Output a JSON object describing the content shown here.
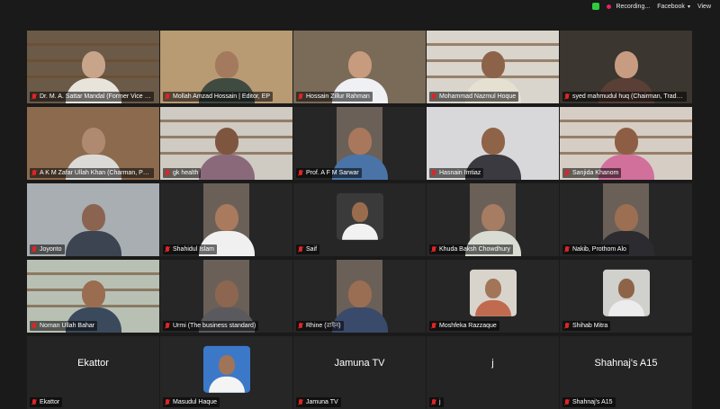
{
  "topbar": {
    "recording_label": "Recording...",
    "app_label": "Facebook",
    "view_label": "View"
  },
  "participants": [
    {
      "name": "Dr. M. A. Sattar Mandal (Former Vice Chancellor...",
      "kind": "video",
      "bg": "#6b5a48",
      "head": "#c8a48a",
      "torso": "#e8e4dc"
    },
    {
      "name": "Mollah Amzad Hossain | Editor, EP",
      "kind": "video",
      "bg": "#b89a73",
      "head": "#a47a5e",
      "torso": "#3f4a40"
    },
    {
      "name": "Hossain Zillur Rahman",
      "kind": "video",
      "bg": "#7a6a58",
      "head": "#c69b7e",
      "torso": "#eef0f4",
      "active": true
    },
    {
      "name": "Mohammad Nazmul Hoque",
      "kind": "video",
      "bg": "#d9d4cc",
      "head": "#8c6248",
      "torso": "#e6e0d2"
    },
    {
      "name": "syed mahmudul huq (Chairman, Trade Se...",
      "kind": "video",
      "bg": "#3b3630",
      "head": "#c79c80",
      "torso": "#5a3f36"
    },
    {
      "name": "A K M Zafar Ullah Khan (Charman, Padma...",
      "kind": "video",
      "bg": "#8c6a4e",
      "head": "#b08a70",
      "torso": "#dcdad6"
    },
    {
      "name": "gk health",
      "kind": "video",
      "bg": "#cfcac2",
      "head": "#7e5640",
      "torso": "#8a6a7a"
    },
    {
      "name": "Prof. A F M Sarwar",
      "kind": "video",
      "bg": "#262626",
      "head": "#a9785c",
      "torso": "#4a74a8",
      "narrow": true
    },
    {
      "name": "Hasnain Imtiaz",
      "kind": "video",
      "bg": "#d8d8da",
      "head": "#8f6347",
      "torso": "#3a3a40"
    },
    {
      "name": "Sanjida Khanom",
      "kind": "video",
      "bg": "#d6cec4",
      "head": "#8e5e44",
      "torso": "#d2709c"
    },
    {
      "name": "Joyonto",
      "kind": "video",
      "bg": "#a8aeb2",
      "head": "#8a6450",
      "torso": "#3c4452"
    },
    {
      "name": "Shahidul Islam",
      "kind": "video",
      "bg": "#262626",
      "head": "#a97a5e",
      "torso": "#f0f0f0",
      "narrow": true
    },
    {
      "name": "Saif",
      "kind": "avatar",
      "bg": "#262626",
      "head": "#9a6c4e",
      "torso": "#f2f2f2",
      "pic_bg": "#3a3a3a"
    },
    {
      "name": "Khuda Baksh Chowdhury",
      "kind": "video",
      "bg": "#262626",
      "head": "#a67c62",
      "torso": "#d8dcd2",
      "narrow": true
    },
    {
      "name": "Nakib, Prothom Alo",
      "kind": "video",
      "bg": "#262626",
      "head": "#9c6e52",
      "torso": "#2c2c30",
      "narrow": true
    },
    {
      "name": "Noman Ullah Bahar",
      "kind": "video",
      "bg": "#b8c0b4",
      "head": "#9a6c50",
      "torso": "#3a4a5c"
    },
    {
      "name": "Urmi (The business standard)",
      "kind": "video",
      "bg": "#262626",
      "head": "#8c6650",
      "torso": "#5a5a5e",
      "narrow": true
    },
    {
      "name": "Rhine (রাইন)",
      "kind": "video",
      "bg": "#262626",
      "head": "#9a6e52",
      "torso": "#3a4a6a",
      "narrow": true
    },
    {
      "name": "Moshfeka Razzaque",
      "kind": "avatar",
      "bg": "#262626",
      "head": "#a27458",
      "torso": "#c06a50",
      "pic_bg": "#d8d4cc"
    },
    {
      "name": "Shihab Mitra",
      "kind": "avatar",
      "bg": "#262626",
      "head": "#8e6448",
      "torso": "#ececec",
      "pic_bg": "#d0d0cc"
    },
    {
      "name": "Ekattor",
      "kind": "text",
      "bg": "#242424"
    },
    {
      "name": "Masudul Haque",
      "kind": "avatar",
      "bg": "#262626",
      "head": "#a07458",
      "torso": "#f4f4f4",
      "pic_bg": "#3c78c8"
    },
    {
      "name": "Jamuna TV",
      "kind": "text",
      "bg": "#242424"
    },
    {
      "name": "j",
      "kind": "text",
      "bg": "#242424"
    },
    {
      "name": "Shahnaj's A15",
      "kind": "text",
      "bg": "#242424"
    }
  ]
}
